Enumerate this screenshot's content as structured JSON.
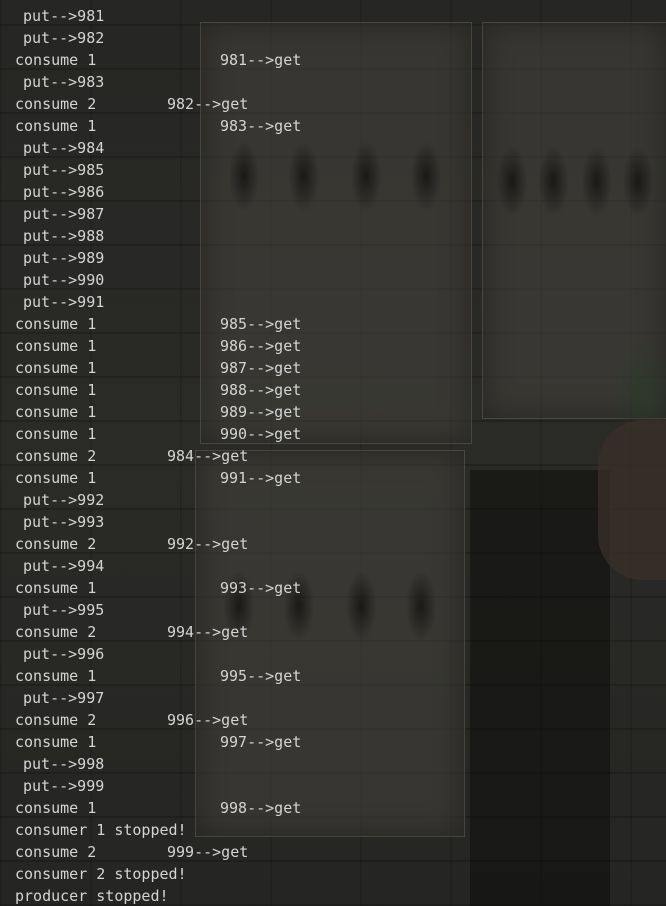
{
  "terminal": {
    "colors": {
      "text": "#d4d4d4",
      "background": "#232321"
    },
    "lines": [
      {
        "kind": "put",
        "text": "put-->981"
      },
      {
        "kind": "put",
        "text": "put-->982"
      },
      {
        "kind": "consume",
        "consumer": "consume 1",
        "get": "981-->get"
      },
      {
        "kind": "put",
        "text": "put-->983"
      },
      {
        "kind": "consume",
        "consumer": "consume 2",
        "get": "982-->get"
      },
      {
        "kind": "consume",
        "consumer": "consume 1",
        "get": "983-->get"
      },
      {
        "kind": "put",
        "text": "put-->984"
      },
      {
        "kind": "put",
        "text": "put-->985"
      },
      {
        "kind": "put",
        "text": "put-->986"
      },
      {
        "kind": "put",
        "text": "put-->987"
      },
      {
        "kind": "put",
        "text": "put-->988"
      },
      {
        "kind": "put",
        "text": "put-->989"
      },
      {
        "kind": "put",
        "text": "put-->990"
      },
      {
        "kind": "put",
        "text": "put-->991"
      },
      {
        "kind": "consume",
        "consumer": "consume 1",
        "get": "985-->get"
      },
      {
        "kind": "consume",
        "consumer": "consume 1",
        "get": "986-->get"
      },
      {
        "kind": "consume",
        "consumer": "consume 1",
        "get": "987-->get"
      },
      {
        "kind": "consume",
        "consumer": "consume 1",
        "get": "988-->get"
      },
      {
        "kind": "consume",
        "consumer": "consume 1",
        "get": "989-->get"
      },
      {
        "kind": "consume",
        "consumer": "consume 1",
        "get": "990-->get"
      },
      {
        "kind": "consume",
        "consumer": "consume 2",
        "get": "984-->get"
      },
      {
        "kind": "consume",
        "consumer": "consume 1",
        "get": "991-->get"
      },
      {
        "kind": "put",
        "text": "put-->992"
      },
      {
        "kind": "put",
        "text": "put-->993"
      },
      {
        "kind": "consume",
        "consumer": "consume 2",
        "get": "992-->get"
      },
      {
        "kind": "put",
        "text": "put-->994"
      },
      {
        "kind": "consume",
        "consumer": "consume 1",
        "get": "993-->get"
      },
      {
        "kind": "put",
        "text": "put-->995"
      },
      {
        "kind": "consume",
        "consumer": "consume 2",
        "get": "994-->get"
      },
      {
        "kind": "put",
        "text": "put-->996"
      },
      {
        "kind": "consume",
        "consumer": "consume 1",
        "get": "995-->get"
      },
      {
        "kind": "put",
        "text": "put-->997"
      },
      {
        "kind": "consume",
        "consumer": "consume 2",
        "get": "996-->get"
      },
      {
        "kind": "consume",
        "consumer": "consume 1",
        "get": "997-->get"
      },
      {
        "kind": "put",
        "text": "put-->998"
      },
      {
        "kind": "put",
        "text": "put-->999"
      },
      {
        "kind": "consume",
        "consumer": "consume 1",
        "get": "998-->get"
      },
      {
        "kind": "status",
        "text": "consumer 1 stopped!"
      },
      {
        "kind": "consume",
        "consumer": "consume 2",
        "get": "999-->get"
      },
      {
        "kind": "status",
        "text": "consumer 2 stopped!"
      },
      {
        "kind": "status",
        "text": "producer stopped!"
      }
    ]
  }
}
